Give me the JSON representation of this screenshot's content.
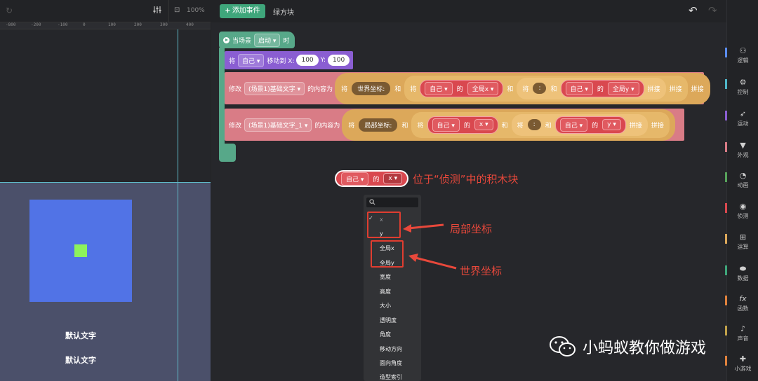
{
  "left_panel": {
    "zoom": "100%",
    "ruler_ticks": [
      "-800",
      "-200",
      "-100",
      "0",
      "100",
      "200",
      "300",
      "400"
    ],
    "default_text_1": "默认文字",
    "default_text_2": "默认文字"
  },
  "topbar": {
    "add_event_label": "添加事件",
    "sprite_name": "绿方块"
  },
  "blocks": {
    "event": {
      "prefix": "当场景",
      "dropdown": "启动",
      "suffix": "时"
    },
    "move": {
      "prefix": "将",
      "target": "自己",
      "action": "移动到 X:",
      "x_value": "100",
      "y_label": "Y:",
      "y_value": "100"
    },
    "modify1": {
      "prefix": "修改",
      "target": "(场景1)基础文字",
      "content_label": "的内容为",
      "w_jiang": "将",
      "text": "世界坐标:",
      "w_he": "和",
      "obj1": "自己",
      "w_de": "的",
      "prop1": "全局x",
      "sep": ":",
      "obj2": "自己",
      "prop2": "全局y",
      "join": "拼接"
    },
    "modify2": {
      "prefix": "修改",
      "target": "(场景1)基础文字_1",
      "content_label": "的内容为",
      "w_jiang": "将",
      "text": "局部坐标:",
      "w_he": "和",
      "obj1": "自己",
      "w_de": "的",
      "prop1": "x",
      "sep": ":",
      "obj2": "自己",
      "prop2": "y",
      "join": "拼接"
    }
  },
  "annotation": {
    "sample_obj": "自己",
    "sample_de": "的",
    "sample_prop": "x",
    "sensing_note": "位于“侦测”中的积木块",
    "local_note": "局部坐标",
    "world_note": "世界坐标"
  },
  "dropdown_menu": {
    "selected": "x",
    "items": [
      "x",
      "y",
      "全局x",
      "全局y",
      "宽度",
      "高度",
      "大小",
      "透明度",
      "角度",
      "移动方向",
      "面向角度",
      "造型索引"
    ]
  },
  "categories": [
    {
      "label": "逻辑",
      "icon": "logic-icon",
      "color": "#5b8def"
    },
    {
      "label": "控制",
      "icon": "control-icon",
      "color": "#4fb6c8"
    },
    {
      "label": "运动",
      "icon": "motion-icon",
      "color": "#8a5ed2"
    },
    {
      "label": "外观",
      "icon": "looks-icon",
      "color": "#d97c86"
    },
    {
      "label": "动画",
      "icon": "animation-icon",
      "color": "#57a35b"
    },
    {
      "label": "侦测",
      "icon": "sensing-icon",
      "color": "#d9484f"
    },
    {
      "label": "运算",
      "icon": "operators-icon",
      "color": "#dca85a"
    },
    {
      "label": "数据",
      "icon": "data-icon",
      "color": "#3fa67b"
    },
    {
      "label": "函数",
      "icon": "function-icon",
      "color": "#e0823d"
    },
    {
      "label": "声音",
      "icon": "sound-icon",
      "color": "#c0a14a"
    },
    {
      "label": "小游戏",
      "icon": "minigame-icon",
      "color": "#e0823d"
    }
  ],
  "watermark": {
    "text": "小蚂蚁教你做游戏"
  }
}
